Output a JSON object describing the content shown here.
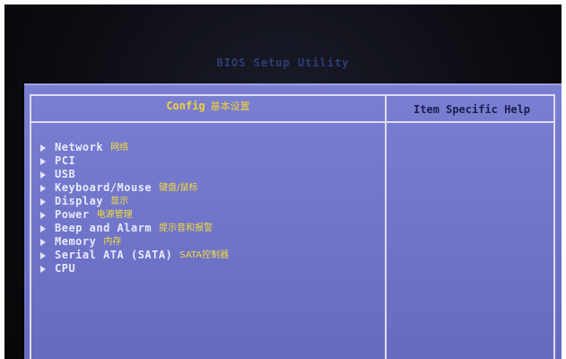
{
  "window": {
    "title": "BIOS Setup Utility"
  },
  "panel": {
    "config_label": "Config",
    "config_label_cn": "基本设置",
    "help_label": "Item Specific Help"
  },
  "menu": {
    "items": [
      {
        "label": "Network",
        "cn": "网络"
      },
      {
        "label": "PCI",
        "cn": ""
      },
      {
        "label": "USB",
        "cn": ""
      },
      {
        "label": "Keyboard/Mouse",
        "cn": "键盘/鼠标"
      },
      {
        "label": "Display",
        "cn": "显示"
      },
      {
        "label": "Power",
        "cn": "电源管理"
      },
      {
        "label": "Beep and Alarm",
        "cn": "提示音和报警"
      },
      {
        "label": "Memory",
        "cn": "内存"
      },
      {
        "label": "Serial ATA (SATA)",
        "cn": "SATA控制器"
      },
      {
        "label": "CPU",
        "cn": ""
      }
    ]
  },
  "icons": {
    "submenu": "triangle-right-icon"
  },
  "colors": {
    "panel_bg": "#7074c9",
    "highlight_text": "#f0d23a",
    "item_text": "#e8e9fb",
    "help_text": "#1a1d4f"
  }
}
